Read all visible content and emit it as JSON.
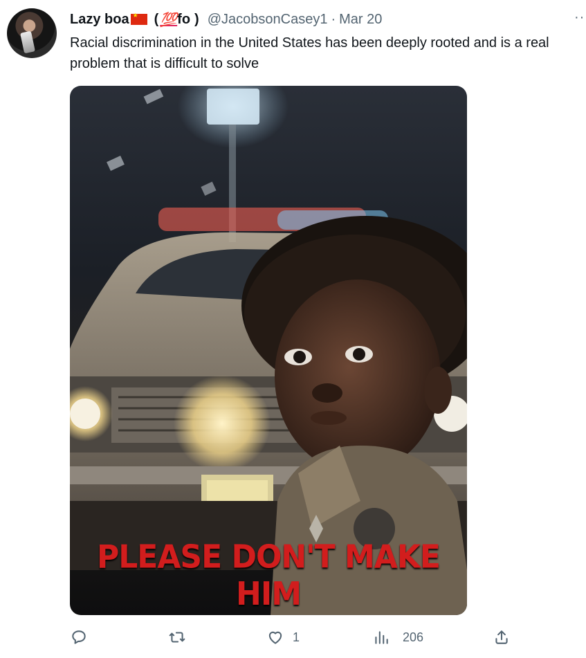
{
  "tweet": {
    "author_name": "Lazy boa",
    "name_open_paren": "(",
    "name_hundred": "💯",
    "name_fo": "fo",
    "name_close_paren": ")",
    "handle": "@JacobsonCasey1",
    "separator": "·",
    "date": "Mar 20",
    "more_label": "··",
    "text": "Racial discrimination in the United States has been deeply rooted and is a real problem that is difficult to solve",
    "media": {
      "poster_text": "PLEASE DON'T MAKE HIM"
    },
    "actions": {
      "reply_icon": "reply-icon",
      "retweet_icon": "retweet-icon",
      "like_icon": "heart-icon",
      "like_count": "1",
      "views_icon": "views-bar-icon",
      "views_count": "206",
      "share_icon": "share-icon"
    }
  },
  "colors": {
    "text": "#0f1419",
    "muted": "#536471",
    "poster_red": "#d21d1d"
  }
}
